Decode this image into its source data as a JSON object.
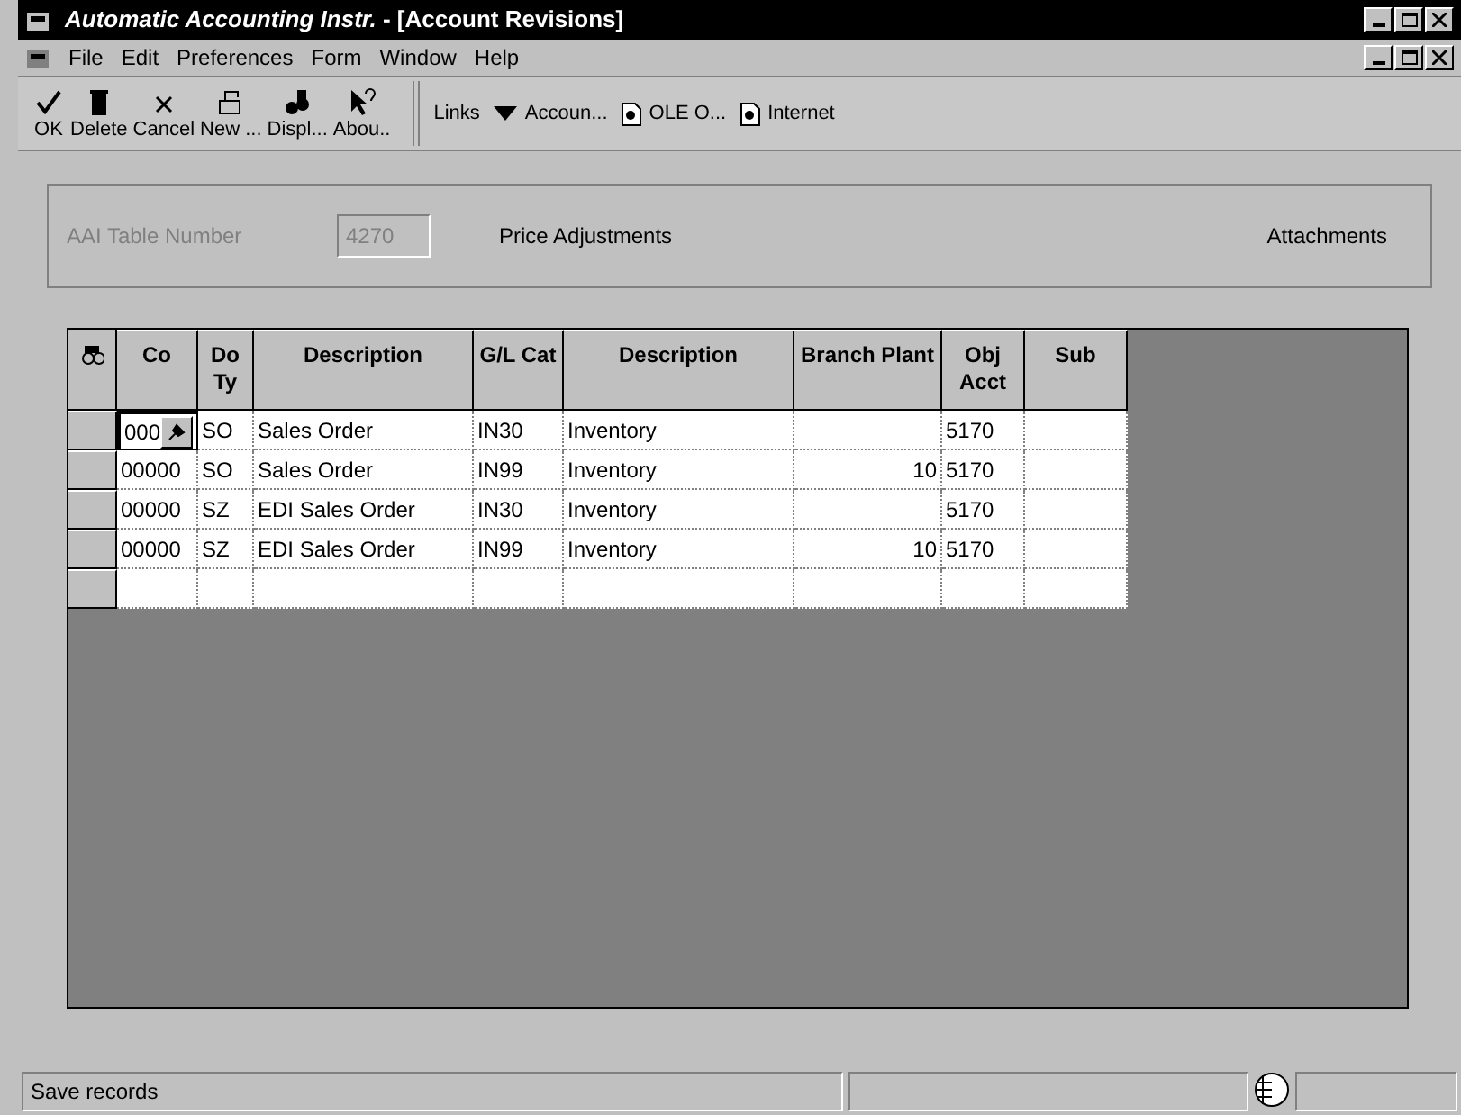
{
  "window": {
    "app_title": "Automatic Accounting Instr.",
    "doc_title": " - [Account Revisions]"
  },
  "menu": [
    "File",
    "Edit",
    "Preferences",
    "Form",
    "Window",
    "Help"
  ],
  "toolbar": [
    {
      "label": "OK",
      "kind": "ok"
    },
    {
      "label": "Delete",
      "kind": "delete"
    },
    {
      "label": "Cancel",
      "kind": "cancel"
    },
    {
      "label": "New ...",
      "kind": "new"
    },
    {
      "label": "Displ...",
      "kind": "display"
    },
    {
      "label": "Abou..",
      "kind": "about"
    }
  ],
  "links": [
    {
      "label": "Links",
      "kind": "plain"
    },
    {
      "label": "Accoun...",
      "kind": "dropdown"
    },
    {
      "label": "OLE O...",
      "kind": "doc"
    },
    {
      "label": "Internet",
      "kind": "doc"
    }
  ],
  "header": {
    "label": "AAI Table Number",
    "value": "4270",
    "disabled": true,
    "description": "Price Adjustments",
    "attachments": "Attachments"
  },
  "table": {
    "columns": [
      "Co",
      "Do Ty",
      "Description",
      "G/L Cat",
      "Description",
      "Branch Plant",
      "Obj Acct",
      "Sub"
    ],
    "rows": [
      {
        "focused": true,
        "cells": [
          "000",
          "SO",
          "Sales Order",
          "IN30",
          "Inventory",
          "",
          "5170",
          ""
        ]
      },
      {
        "focused": false,
        "cells": [
          "00000",
          "SO",
          "Sales Order",
          "IN99",
          "Inventory",
          "10",
          "5170",
          ""
        ]
      },
      {
        "focused": false,
        "cells": [
          "00000",
          "SZ",
          "EDI Sales Order",
          "IN30",
          "Inventory",
          "",
          "5170",
          ""
        ]
      },
      {
        "focused": false,
        "cells": [
          "00000",
          "SZ",
          "EDI Sales Order",
          "IN99",
          "Inventory",
          "10",
          "5170",
          ""
        ]
      },
      {
        "focused": false,
        "cells": [
          "",
          "",
          "",
          "",
          "",
          "",
          "",
          ""
        ]
      }
    ]
  },
  "status_bar": {
    "message": "Save records"
  }
}
